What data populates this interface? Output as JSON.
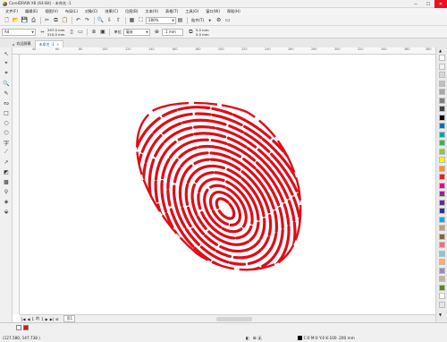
{
  "window": {
    "title": "CorelDRAW X8 (64-Bit) - 未命名 -1"
  },
  "menu": [
    "文件(F)",
    "编辑(E)",
    "视图(V)",
    "布局(L)",
    "对象(C)",
    "效果(C)",
    "位图(B)",
    "文本(X)",
    "表格(T)",
    "工具(O)",
    "窗口(W)",
    "帮助(H)"
  ],
  "toolbar": {
    "zoom": "280%",
    "snap_label": "贴齐(T)"
  },
  "properties": {
    "page_size": "A4",
    "width": "297.0 mm",
    "height": "210.0 mm",
    "units_label": "单位",
    "units": "毫米",
    "nudge": ".1 mm",
    "dup_x": "5.0 mm",
    "dup_y": "5.0 mm"
  },
  "tabs": [
    {
      "label": "欢迎屏幕"
    },
    {
      "label": "未命名 -1"
    }
  ],
  "ruler": {
    "h_ticks": [
      "40",
      "60",
      "80",
      "100",
      "120",
      "140",
      "160",
      "180",
      "200",
      "220",
      "240",
      "260",
      "280",
      "300",
      "320",
      "340",
      "360",
      "380"
    ]
  },
  "canvas": {
    "fingerprint_color": "#dd0e18"
  },
  "page_nav": {
    "current": "1",
    "of": "的",
    "total": "1",
    "page_tab": "页1"
  },
  "status": {
    "coords": "(127.580, 147.738 )",
    "fill_label": "无",
    "color_info": "C:0 M:0 Y:0 K:100 .200 mm"
  },
  "palette": [
    "#ffffff",
    "#f2f2f2",
    "#d9d9d9",
    "#bfbfbf",
    "#a6a6a6",
    "#808080",
    "#404040",
    "#000000",
    "#0072bc",
    "#00a99d",
    "#39b54a",
    "#8dc63f",
    "#fff200",
    "#f7941d",
    "#ed1c24",
    "#ec008c",
    "#92278f",
    "#662d91",
    "#2e3192",
    "#00aeef",
    "#c69c6d",
    "#8c6239",
    "#f26d7d",
    "#7accc8",
    "#fbaf5d",
    "#a186be",
    "#c2b59b",
    "#598527",
    "#ffffff",
    "#e6e6e6"
  ]
}
